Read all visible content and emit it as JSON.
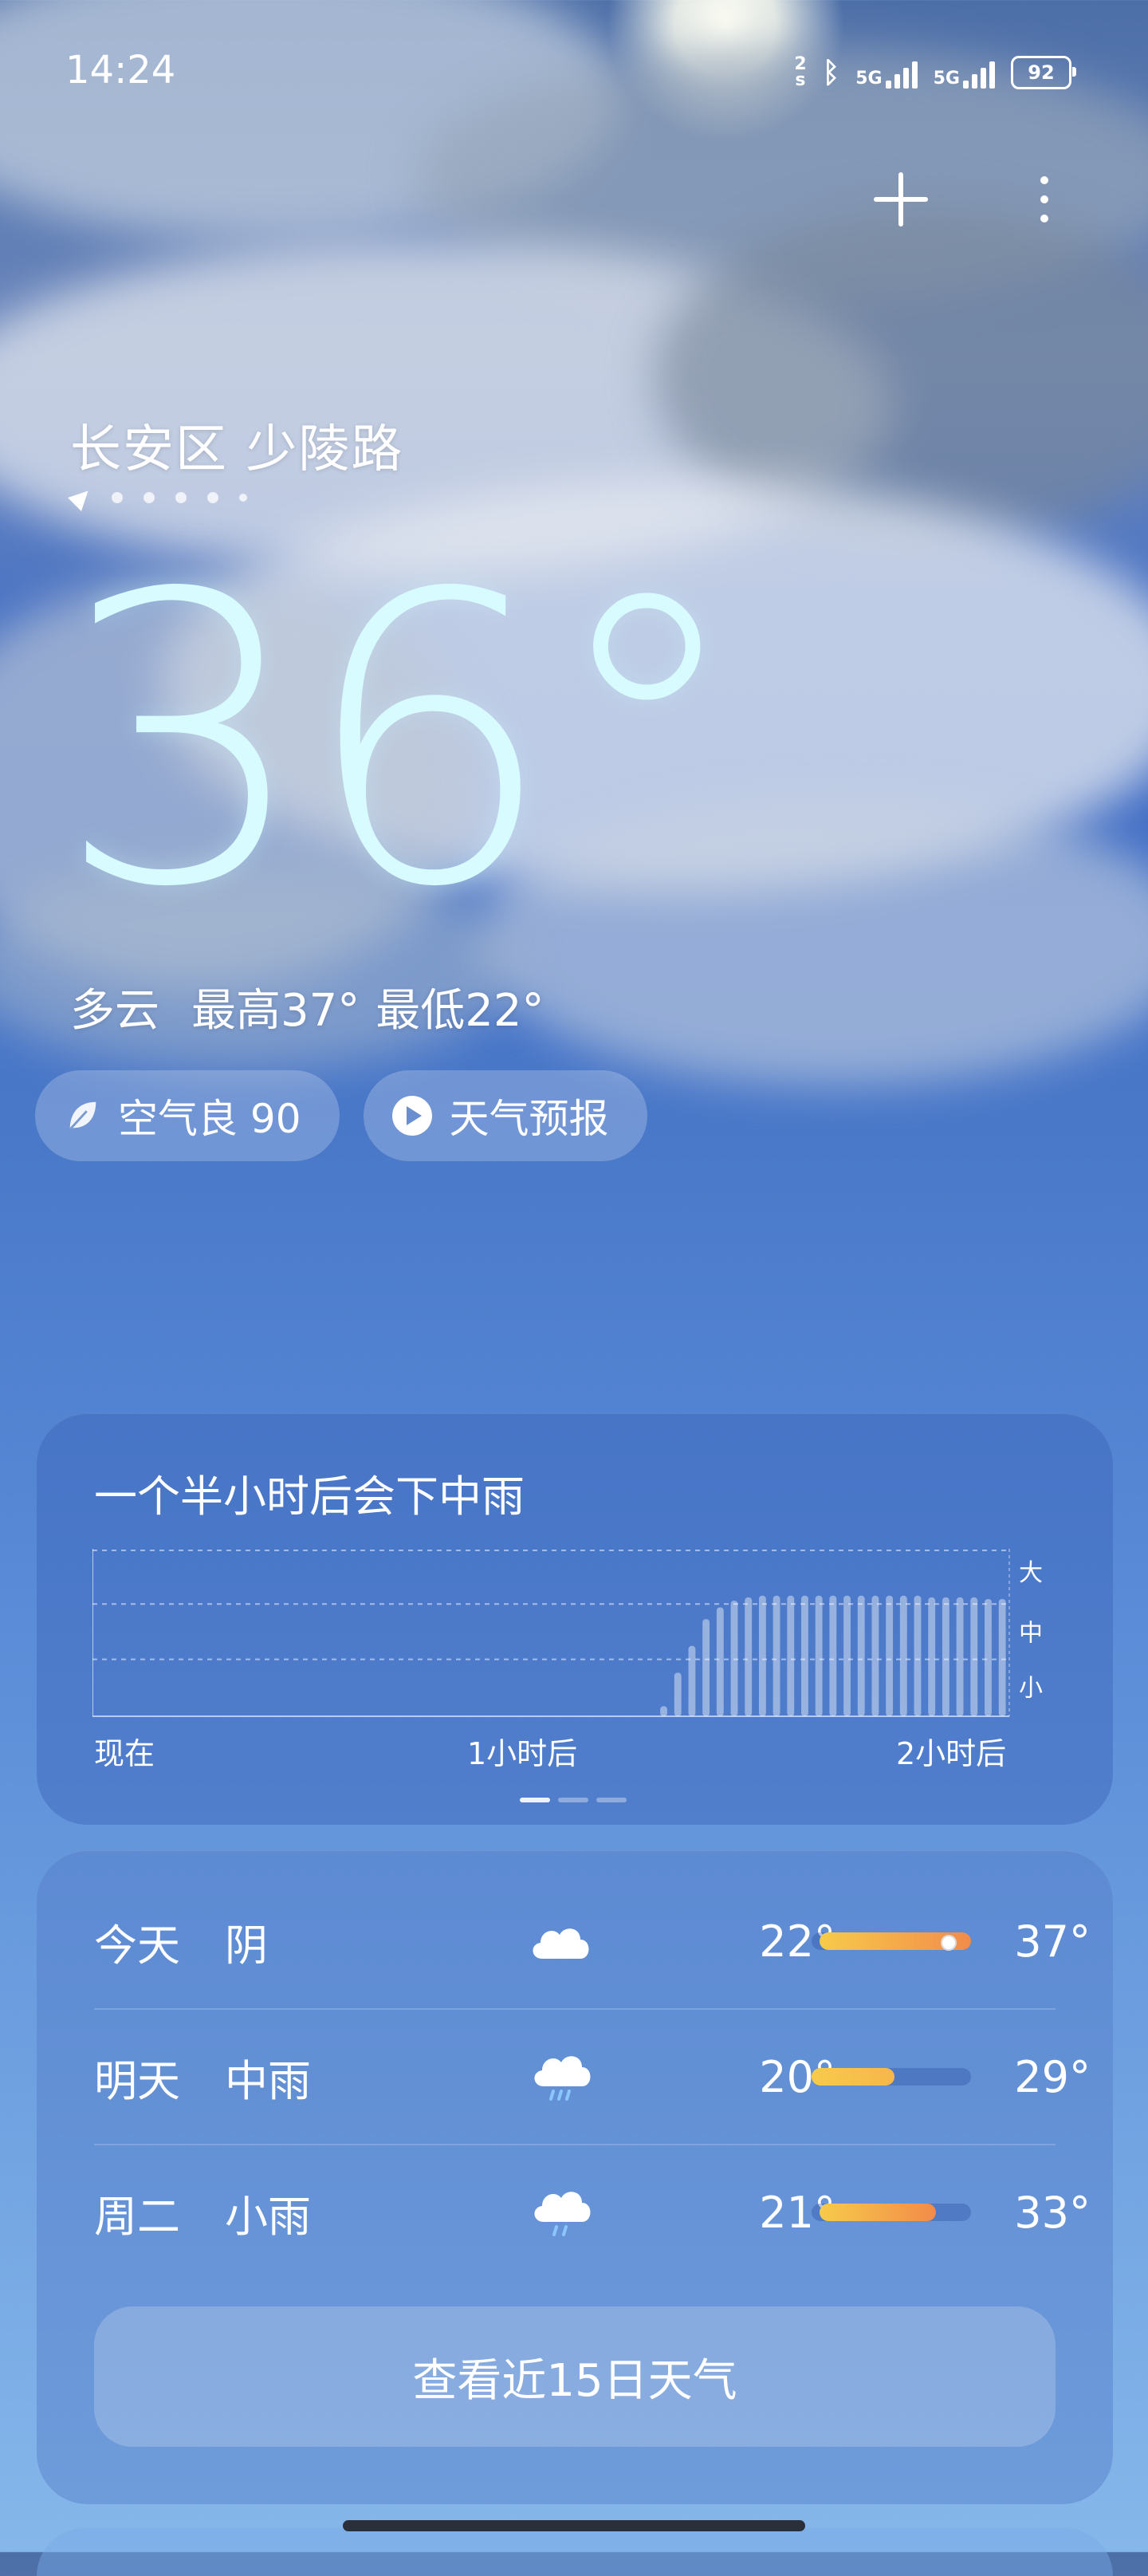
{
  "status_bar": {
    "time": "14:24",
    "net_speed": "2",
    "net_unit": "s",
    "signal1": "5G",
    "signal2": "5G",
    "battery": "92"
  },
  "header": {
    "add_icon": "plus-icon",
    "more_icon": "more-vertical-icon"
  },
  "location": {
    "name": "长安区 少陵路",
    "page_count": 5
  },
  "current": {
    "temperature": "36°",
    "condition": "多云",
    "high": "最高37°",
    "low": "最低22°"
  },
  "chips": {
    "air_quality": "空气良 90",
    "forecast_video": "天气预报"
  },
  "rain": {
    "title": "一个半小时后会下中雨",
    "x_labels": [
      "现在",
      "1小时后",
      "2小时后"
    ],
    "y_labels": [
      "大",
      "中",
      "小"
    ]
  },
  "chart_data": {
    "type": "bar",
    "title": "一个半小时后会下中雨",
    "categories": [
      "现在",
      "1小时后",
      "2小时后"
    ],
    "y_categories": [
      "小",
      "中",
      "大"
    ],
    "series": [
      {
        "values": [
          0,
          0,
          0,
          0,
          0,
          0,
          0,
          0,
          0,
          0,
          0,
          0,
          0,
          0,
          0,
          0,
          0,
          0,
          0,
          0,
          0,
          0,
          0,
          0,
          0,
          0,
          0,
          0,
          0,
          0,
          0,
          0,
          0,
          0,
          0,
          0,
          0,
          0,
          0,
          0,
          0.06,
          0.26,
          0.42,
          0.58,
          0.65,
          0.69,
          0.71,
          0.72,
          0.72,
          0.72,
          0.72,
          0.72,
          0.72,
          0.72,
          0.72,
          0.72,
          0.72,
          0.72,
          0.72,
          0.71,
          0.71,
          0.71,
          0.71,
          0.7,
          0.7
        ]
      }
    ],
    "ylim": [
      0,
      1
    ]
  },
  "forecast": {
    "rows": [
      {
        "day": "今天",
        "condition": "阴",
        "icon": "cloud-icon",
        "low": "22°",
        "high": "37°",
        "bar_start": 0.1,
        "bar_end": 1.0,
        "current_marker": 0.85
      },
      {
        "day": "明天",
        "condition": "中雨",
        "icon": "cloud-rain-icon",
        "low": "20°",
        "high": "29°",
        "bar_start": 0.0,
        "bar_end": 0.55
      },
      {
        "day": "周二",
        "condition": "小雨",
        "icon": "cloud-rain-icon",
        "low": "21°",
        "high": "33°",
        "bar_start": 0.05,
        "bar_end": 0.78
      }
    ],
    "more_button": "查看近15日天气"
  },
  "colors": {
    "temp_text": "#d8fbff",
    "bar_warm": "#f59b45",
    "bar_yellow": "#f7cb4a"
  }
}
